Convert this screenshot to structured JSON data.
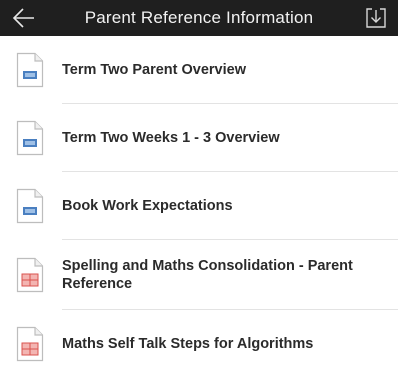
{
  "header": {
    "title": "Parent Reference Information",
    "back_icon": "arrow-left-icon",
    "download_icon": "download-icon"
  },
  "items": [
    {
      "label": "Term Two Parent Overview",
      "icon": "document-icon",
      "icon_color": "#4a7fc0"
    },
    {
      "label": "Term Two Weeks 1 - 3 Overview",
      "icon": "document-icon",
      "icon_color": "#4a7fc0"
    },
    {
      "label": "Book Work Expectations",
      "icon": "document-icon",
      "icon_color": "#4a7fc0"
    },
    {
      "label": "Spelling and Maths Consolidation - Parent Reference",
      "icon": "spreadsheet-icon",
      "icon_color": "#d9534f"
    },
    {
      "label": "Maths Self Talk Steps for Algorithms",
      "icon": "spreadsheet-icon",
      "icon_color": "#d9534f"
    }
  ],
  "colors": {
    "header_bg": "#1f1f1f",
    "header_text": "#f2f2f2",
    "doc_accent": "#4a7fc0",
    "sheet_accent": "#d9534f"
  }
}
